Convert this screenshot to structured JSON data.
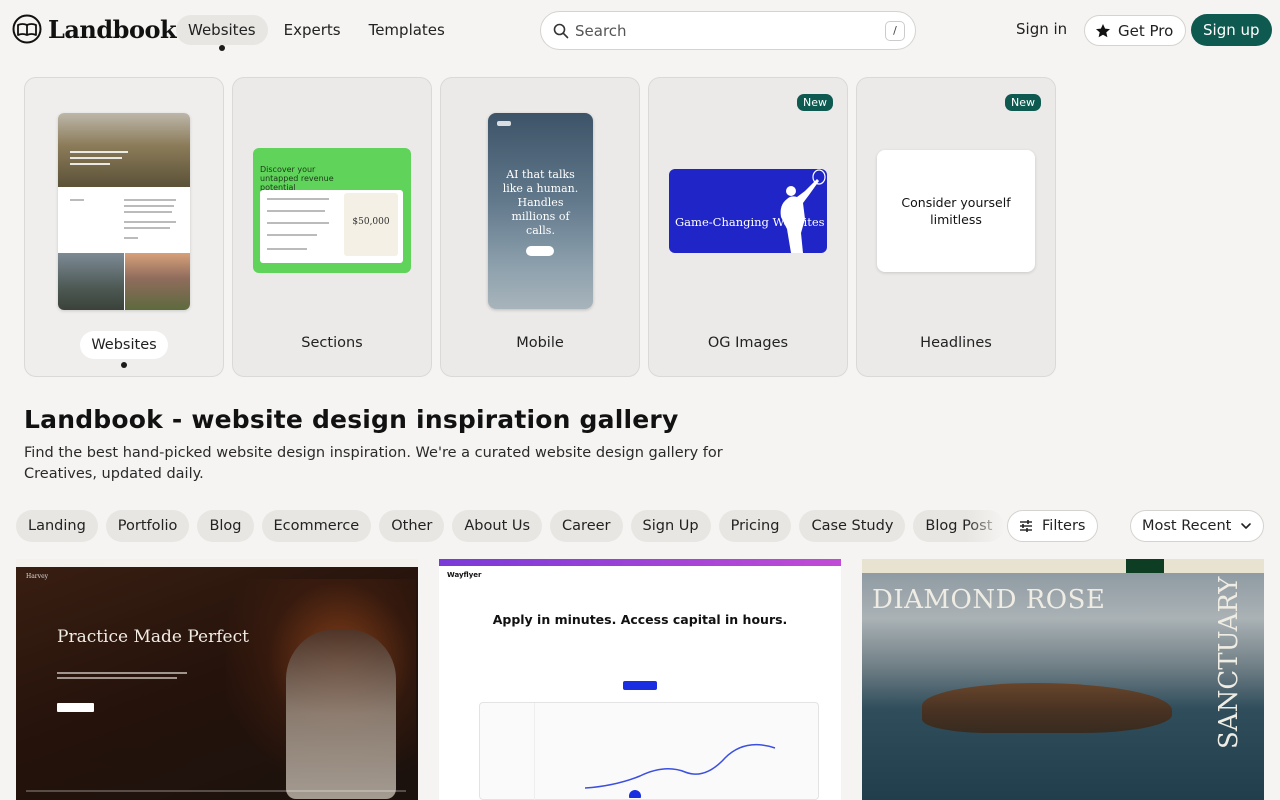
{
  "header": {
    "logo_text": "Landbook",
    "nav": [
      {
        "label": "Websites",
        "active": true
      },
      {
        "label": "Experts",
        "active": false
      },
      {
        "label": "Templates",
        "active": false
      }
    ],
    "search": {
      "placeholder": "Search",
      "shortcut": "/"
    },
    "sign_in": "Sign in",
    "get_pro": "Get Pro",
    "sign_up": "Sign up",
    "brand_color": "#0f5a50"
  },
  "categories": [
    {
      "label": "Websites",
      "active": true,
      "badge": ""
    },
    {
      "label": "Sections",
      "active": false,
      "badge": ""
    },
    {
      "label": "Mobile",
      "active": false,
      "badge": ""
    },
    {
      "label": "OG Images",
      "active": false,
      "badge": "New"
    },
    {
      "label": "Headlines",
      "active": false,
      "badge": "New"
    }
  ],
  "thumbs": {
    "sections_headline": "Discover your untapped revenue potential",
    "sections_price": "$50,000",
    "mobile_headline": "AI that talks like a human. Handles millions of calls.",
    "og_headline": "Game-Changing Websites",
    "headline_text": "Consider yourself limitless"
  },
  "intro": {
    "title": "Landbook - website design inspiration gallery",
    "description": "Find the best hand-picked website design inspiration. We're a curated website design gallery for Creatives, updated daily."
  },
  "filter_chips": [
    "Landing",
    "Portfolio",
    "Blog",
    "Ecommerce",
    "Other",
    "About Us",
    "Career",
    "Sign Up",
    "Pricing",
    "Case Study",
    "Blog Post"
  ],
  "filters_label": "Filters",
  "sort_label": "Most Recent",
  "gallery": [
    {
      "brand": "Harvey",
      "headline": "Practice Made Perfect"
    },
    {
      "brand": "Wayflyer",
      "headline": "Apply in minutes. Access capital in hours."
    },
    {
      "brand": "Diamond Rose",
      "headline": "DIAMOND ROSE",
      "side_text": "SANCTUARY"
    }
  ]
}
